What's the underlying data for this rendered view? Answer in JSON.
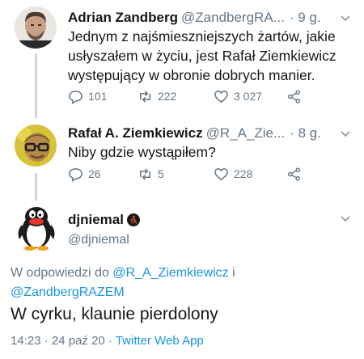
{
  "tweets": [
    {
      "name": "Adrian Zandberg",
      "handle": "@ZandbergRA...",
      "time": "· 9 g.",
      "text": "Jednym z najśmieszniejszych żartów, jakie usłyszałem w życiu, jest Rafał Ziemkiewicz występujący w obronie dobrych manier.",
      "replies": "101",
      "retweets": "222",
      "likes": "3 027"
    },
    {
      "name": "Rafał A. Ziemkiewicz",
      "handle": "@R_A_Zie...",
      "time": "· 8 g.",
      "text": "Niby gdzie wystąpiłem?",
      "replies": "26",
      "retweets": "5",
      "likes": "228"
    }
  ],
  "main_tweet": {
    "name": "djniemal",
    "handle": "@djniemal",
    "reply_prefix": "W odpowiedzi do",
    "reply_user1": "@R_A_Ziemkiewicz",
    "reply_joiner": "i",
    "reply_user2": "@ZandbergRAZEM",
    "text": "W cyrku, klaunie pierdolony",
    "timestamp": "14:23 · 24 paź 20 ·",
    "source": "Twitter Web App"
  },
  "colors": {
    "link": "#1b95e0",
    "secondary_text": "#657786",
    "thread_line": "#cdd6dd"
  }
}
